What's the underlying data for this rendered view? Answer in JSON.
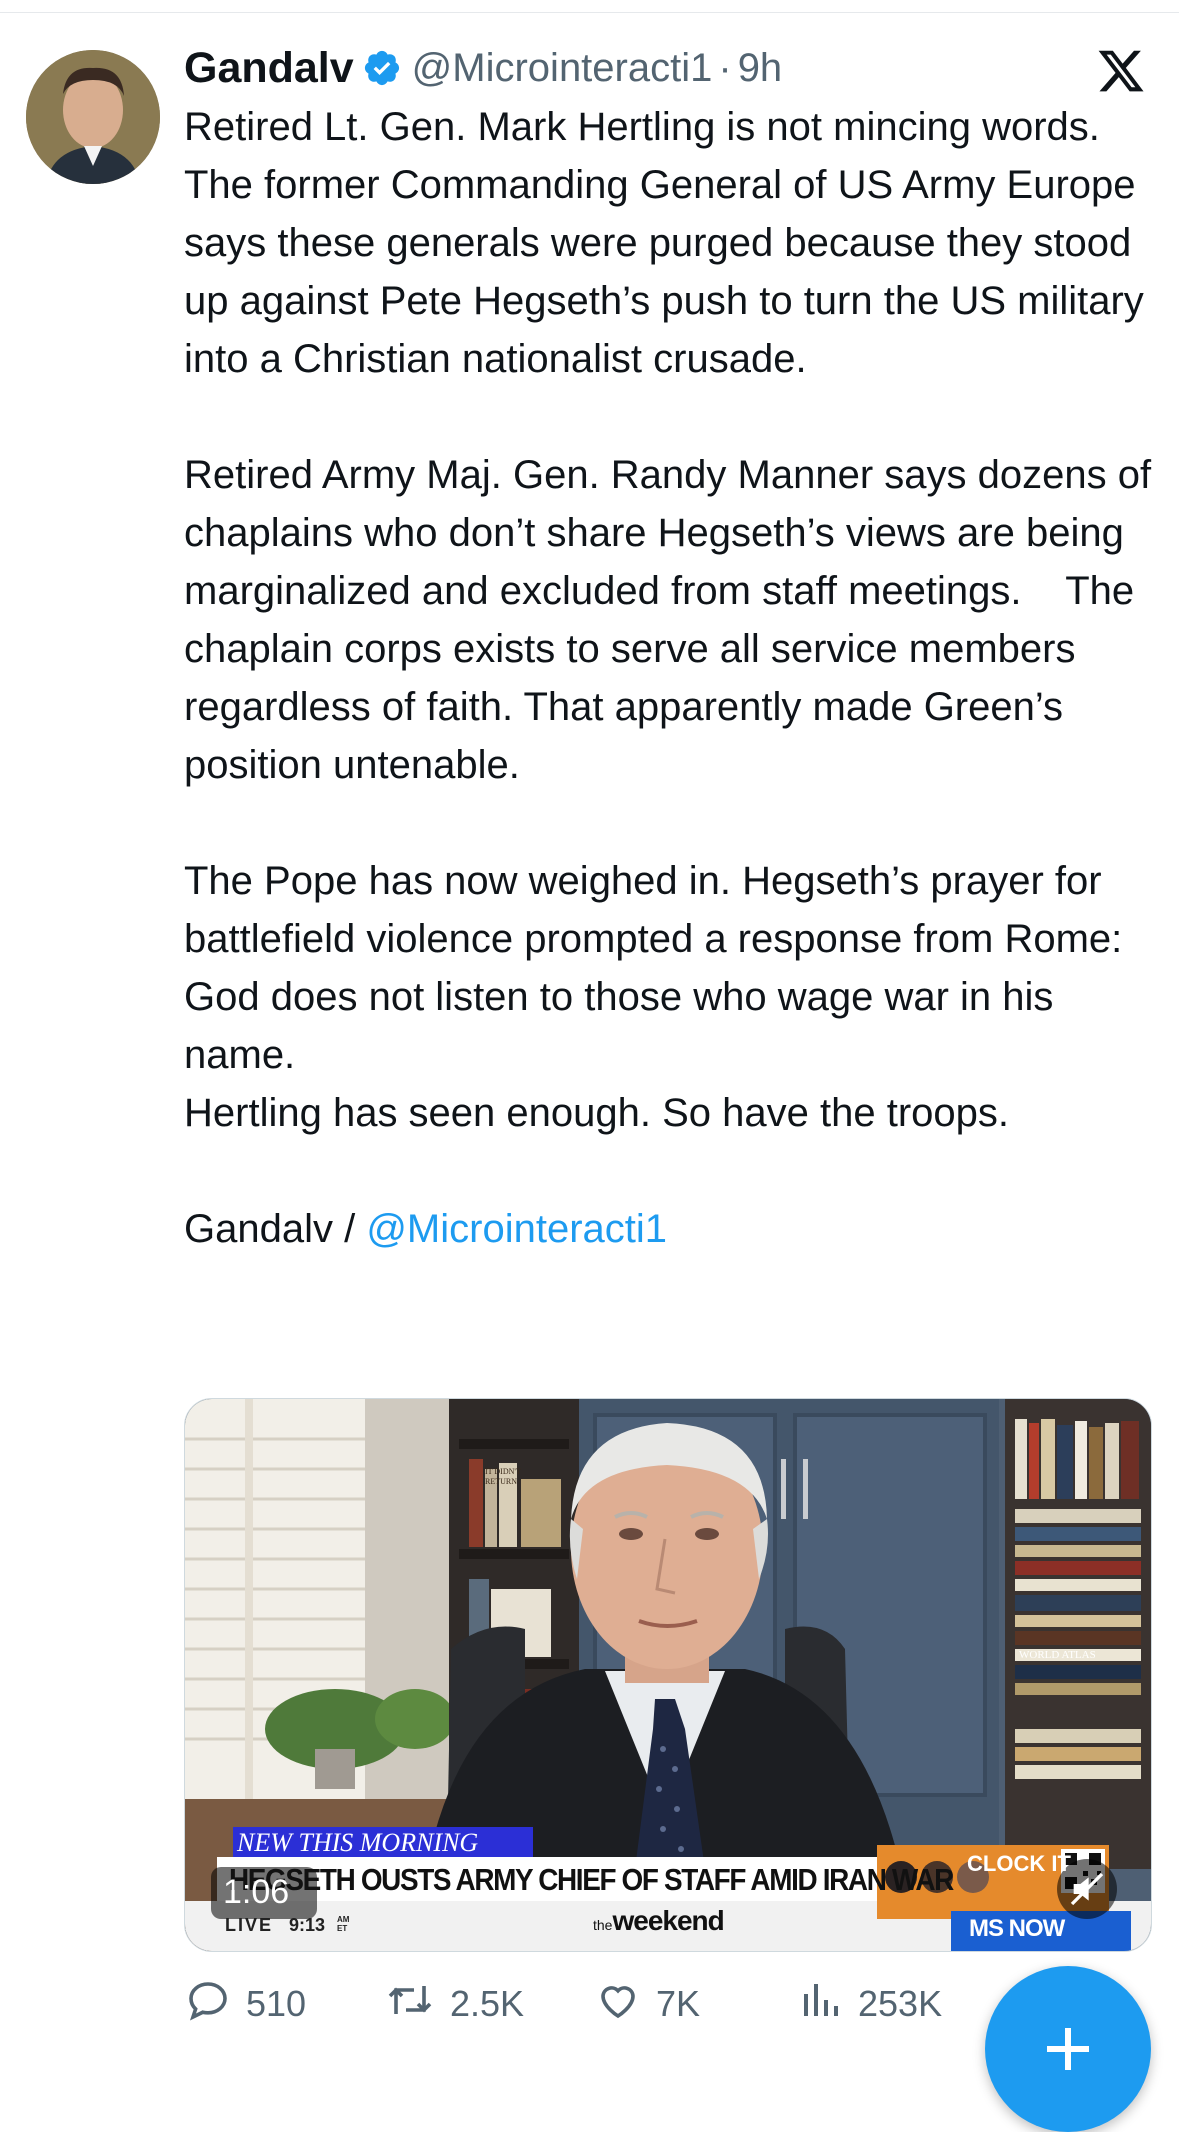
{
  "tweet": {
    "author_name": "Gandalv",
    "handle": "@Microinteracti1",
    "separator": "·",
    "time": "9h",
    "paragraphs": [
      "Retired Lt. Gen. Mark Hertling is not mincing words. The former Commanding General of US Army Europe says these generals were purged because they stood up against Pete Hegseth’s push to turn the US military into a Christian nationalist crusade.",
      "Retired Army Maj. Gen. Randy Manner says dozens of chaplains who don’t share Hegseth’s views are being marginalized and excluded from staff meetings.    The chaplain corps exists to serve all service members regardless of faith. That apparently made Green’s position untenable.",
      "The Pope has now weighed in. Hegseth’s prayer for battlefield violence prompted a response from Rome: God does not listen to those who wage war in his name.\nHertling has seen enough. So have the troops."
    ],
    "signature_prefix": "Gandalv / ",
    "signature_mention": "@Microinteracti1"
  },
  "video": {
    "banner_tag": "NEW THIS MORNING",
    "headline": "HEGSETH OUSTS ARMY CHIEF OF STAFF AMID IRAN WAR",
    "live_label": "LIVE",
    "live_time": "9:13",
    "live_time_suffix": "AM ET",
    "show_name_prefix": "the",
    "show_name": "weekend",
    "promo_title": "CLOCK IT",
    "network": "MS NOW",
    "duration": "1:06",
    "bookshelf_labels": [
      "WORLD ATLAS",
      "IT DIDN'T RETURN"
    ]
  },
  "actions": {
    "replies": "510",
    "reposts": "2.5K",
    "likes": "7K",
    "views": "253K"
  },
  "colors": {
    "accent": "#1d9bf0",
    "secondary_text": "#536471",
    "primary_text": "#0f1419",
    "msnow_blue": "#1a5fd1",
    "banner_blue": "#2b2fd6"
  },
  "icons": [
    "verified-badge-icon",
    "x-logo-icon",
    "reply-icon",
    "repost-icon",
    "like-icon",
    "views-icon",
    "share-icon",
    "mute-icon",
    "compose-plus-icon"
  ]
}
